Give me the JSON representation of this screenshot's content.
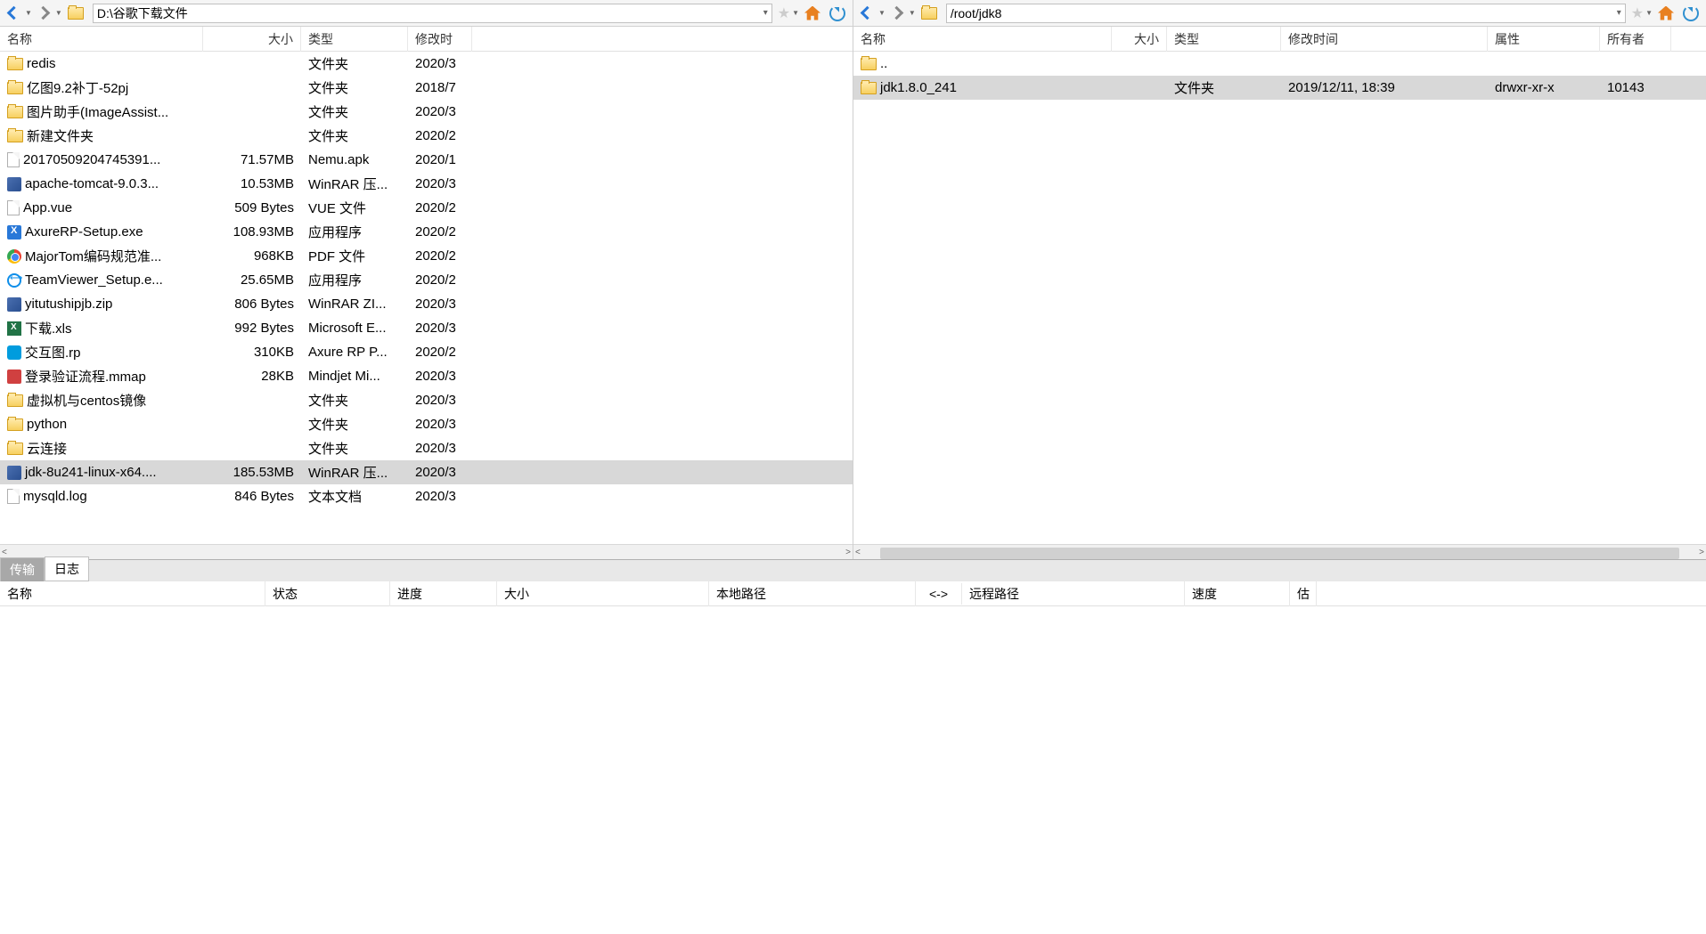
{
  "left_pane": {
    "path": "D:\\谷歌下载文件",
    "headers": {
      "name": "名称",
      "size": "大小",
      "type": "类型",
      "date": "修改时"
    },
    "rows": [
      {
        "icon": "folder",
        "name": "redis",
        "size": "",
        "type": "文件夹",
        "date": "2020/3",
        "selected": false
      },
      {
        "icon": "folder",
        "name": "亿图9.2补丁-52pj",
        "size": "",
        "type": "文件夹",
        "date": "2018/7",
        "selected": false
      },
      {
        "icon": "folder",
        "name": "图片助手(ImageAssist...",
        "size": "",
        "type": "文件夹",
        "date": "2020/3",
        "selected": false
      },
      {
        "icon": "folder",
        "name": "新建文件夹",
        "size": "",
        "type": "文件夹",
        "date": "2020/2",
        "selected": false
      },
      {
        "icon": "file",
        "name": "20170509204745391...",
        "size": "71.57MB",
        "type": "Nemu.apk",
        "date": "2020/1",
        "selected": false
      },
      {
        "icon": "archive",
        "name": "apache-tomcat-9.0.3...",
        "size": "10.53MB",
        "type": "WinRAR 压...",
        "date": "2020/3",
        "selected": false
      },
      {
        "icon": "file",
        "name": "App.vue",
        "size": "509 Bytes",
        "type": "VUE 文件",
        "date": "2020/2",
        "selected": false
      },
      {
        "icon": "exe",
        "name": "AxureRP-Setup.exe",
        "size": "108.93MB",
        "type": "应用程序",
        "date": "2020/2",
        "selected": false
      },
      {
        "icon": "chrome",
        "name": "MajorTom编码规范准...",
        "size": "968KB",
        "type": "PDF 文件",
        "date": "2020/2",
        "selected": false
      },
      {
        "icon": "teamviewer",
        "name": "TeamViewer_Setup.e...",
        "size": "25.65MB",
        "type": "应用程序",
        "date": "2020/2",
        "selected": false
      },
      {
        "icon": "archive",
        "name": "yitutushipjb.zip",
        "size": "806 Bytes",
        "type": "WinRAR ZI...",
        "date": "2020/3",
        "selected": false
      },
      {
        "icon": "excel",
        "name": "下载.xls",
        "size": "992 Bytes",
        "type": "Microsoft E...",
        "date": "2020/3",
        "selected": false
      },
      {
        "icon": "axure",
        "name": "交互图.rp",
        "size": "310KB",
        "type": "Axure RP P...",
        "date": "2020/2",
        "selected": false
      },
      {
        "icon": "mindmap",
        "name": "登录验证流程.mmap",
        "size": "28KB",
        "type": "Mindjet Mi...",
        "date": "2020/3",
        "selected": false
      },
      {
        "icon": "folder",
        "name": "虚拟机与centos镜像",
        "size": "",
        "type": "文件夹",
        "date": "2020/3",
        "selected": false
      },
      {
        "icon": "folder",
        "name": "python",
        "size": "",
        "type": "文件夹",
        "date": "2020/3",
        "selected": false
      },
      {
        "icon": "folder",
        "name": "云连接",
        "size": "",
        "type": "文件夹",
        "date": "2020/3",
        "selected": false
      },
      {
        "icon": "archive",
        "name": "jdk-8u241-linux-x64....",
        "size": "185.53MB",
        "type": "WinRAR 压...",
        "date": "2020/3",
        "selected": true
      },
      {
        "icon": "file",
        "name": "mysqld.log",
        "size": "846 Bytes",
        "type": "文本文档",
        "date": "2020/3",
        "selected": false
      }
    ]
  },
  "right_pane": {
    "path": "/root/jdk8",
    "headers": {
      "name": "名称",
      "size": "大小",
      "type": "类型",
      "date": "修改时间",
      "attr": "属性",
      "owner": "所有者"
    },
    "rows": [
      {
        "icon": "folder",
        "name": "..",
        "size": "",
        "type": "",
        "date": "",
        "attr": "",
        "owner": "",
        "selected": false
      },
      {
        "icon": "folder",
        "name": "jdk1.8.0_241",
        "size": "",
        "type": "文件夹",
        "date": "2019/12/11, 18:39",
        "attr": "drwxr-xr-x",
        "owner": "10143",
        "selected": true
      }
    ]
  },
  "tabs": {
    "transfer": "传输",
    "log": "日志"
  },
  "transfer_headers": {
    "name": "名称",
    "status": "状态",
    "progress": "进度",
    "size": "大小",
    "local_path": "本地路径",
    "direction": "<->",
    "remote_path": "远程路径",
    "speed": "速度",
    "est": "估"
  }
}
